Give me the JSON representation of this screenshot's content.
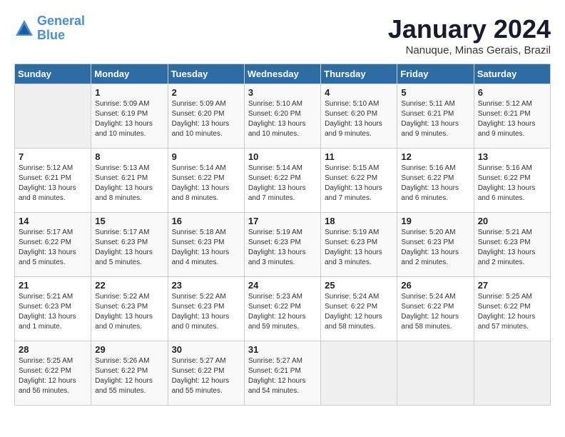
{
  "app": {
    "name": "GeneralBlue",
    "logo_line1": "General",
    "logo_line2": "Blue"
  },
  "calendar": {
    "month_year": "January 2024",
    "location": "Nanuque, Minas Gerais, Brazil",
    "days_of_week": [
      "Sunday",
      "Monday",
      "Tuesday",
      "Wednesday",
      "Thursday",
      "Friday",
      "Saturday"
    ],
    "weeks": [
      [
        {
          "day": "",
          "info": ""
        },
        {
          "day": "1",
          "info": "Sunrise: 5:09 AM\nSunset: 6:19 PM\nDaylight: 13 hours\nand 10 minutes."
        },
        {
          "day": "2",
          "info": "Sunrise: 5:09 AM\nSunset: 6:20 PM\nDaylight: 13 hours\nand 10 minutes."
        },
        {
          "day": "3",
          "info": "Sunrise: 5:10 AM\nSunset: 6:20 PM\nDaylight: 13 hours\nand 10 minutes."
        },
        {
          "day": "4",
          "info": "Sunrise: 5:10 AM\nSunset: 6:20 PM\nDaylight: 13 hours\nand 9 minutes."
        },
        {
          "day": "5",
          "info": "Sunrise: 5:11 AM\nSunset: 6:21 PM\nDaylight: 13 hours\nand 9 minutes."
        },
        {
          "day": "6",
          "info": "Sunrise: 5:12 AM\nSunset: 6:21 PM\nDaylight: 13 hours\nand 9 minutes."
        }
      ],
      [
        {
          "day": "7",
          "info": "Sunrise: 5:12 AM\nSunset: 6:21 PM\nDaylight: 13 hours\nand 8 minutes."
        },
        {
          "day": "8",
          "info": "Sunrise: 5:13 AM\nSunset: 6:21 PM\nDaylight: 13 hours\nand 8 minutes."
        },
        {
          "day": "9",
          "info": "Sunrise: 5:14 AM\nSunset: 6:22 PM\nDaylight: 13 hours\nand 8 minutes."
        },
        {
          "day": "10",
          "info": "Sunrise: 5:14 AM\nSunset: 6:22 PM\nDaylight: 13 hours\nand 7 minutes."
        },
        {
          "day": "11",
          "info": "Sunrise: 5:15 AM\nSunset: 6:22 PM\nDaylight: 13 hours\nand 7 minutes."
        },
        {
          "day": "12",
          "info": "Sunrise: 5:16 AM\nSunset: 6:22 PM\nDaylight: 13 hours\nand 6 minutes."
        },
        {
          "day": "13",
          "info": "Sunrise: 5:16 AM\nSunset: 6:22 PM\nDaylight: 13 hours\nand 6 minutes."
        }
      ],
      [
        {
          "day": "14",
          "info": "Sunrise: 5:17 AM\nSunset: 6:22 PM\nDaylight: 13 hours\nand 5 minutes."
        },
        {
          "day": "15",
          "info": "Sunrise: 5:17 AM\nSunset: 6:23 PM\nDaylight: 13 hours\nand 5 minutes."
        },
        {
          "day": "16",
          "info": "Sunrise: 5:18 AM\nSunset: 6:23 PM\nDaylight: 13 hours\nand 4 minutes."
        },
        {
          "day": "17",
          "info": "Sunrise: 5:19 AM\nSunset: 6:23 PM\nDaylight: 13 hours\nand 3 minutes."
        },
        {
          "day": "18",
          "info": "Sunrise: 5:19 AM\nSunset: 6:23 PM\nDaylight: 13 hours\nand 3 minutes."
        },
        {
          "day": "19",
          "info": "Sunrise: 5:20 AM\nSunset: 6:23 PM\nDaylight: 13 hours\nand 2 minutes."
        },
        {
          "day": "20",
          "info": "Sunrise: 5:21 AM\nSunset: 6:23 PM\nDaylight: 13 hours\nand 2 minutes."
        }
      ],
      [
        {
          "day": "21",
          "info": "Sunrise: 5:21 AM\nSunset: 6:23 PM\nDaylight: 13 hours\nand 1 minute."
        },
        {
          "day": "22",
          "info": "Sunrise: 5:22 AM\nSunset: 6:23 PM\nDaylight: 13 hours\nand 0 minutes."
        },
        {
          "day": "23",
          "info": "Sunrise: 5:22 AM\nSunset: 6:23 PM\nDaylight: 13 hours\nand 0 minutes."
        },
        {
          "day": "24",
          "info": "Sunrise: 5:23 AM\nSunset: 6:22 PM\nDaylight: 12 hours\nand 59 minutes."
        },
        {
          "day": "25",
          "info": "Sunrise: 5:24 AM\nSunset: 6:22 PM\nDaylight: 12 hours\nand 58 minutes."
        },
        {
          "day": "26",
          "info": "Sunrise: 5:24 AM\nSunset: 6:22 PM\nDaylight: 12 hours\nand 58 minutes."
        },
        {
          "day": "27",
          "info": "Sunrise: 5:25 AM\nSunset: 6:22 PM\nDaylight: 12 hours\nand 57 minutes."
        }
      ],
      [
        {
          "day": "28",
          "info": "Sunrise: 5:25 AM\nSunset: 6:22 PM\nDaylight: 12 hours\nand 56 minutes."
        },
        {
          "day": "29",
          "info": "Sunrise: 5:26 AM\nSunset: 6:22 PM\nDaylight: 12 hours\nand 55 minutes."
        },
        {
          "day": "30",
          "info": "Sunrise: 5:27 AM\nSunset: 6:22 PM\nDaylight: 12 hours\nand 55 minutes."
        },
        {
          "day": "31",
          "info": "Sunrise: 5:27 AM\nSunset: 6:21 PM\nDaylight: 12 hours\nand 54 minutes."
        },
        {
          "day": "",
          "info": ""
        },
        {
          "day": "",
          "info": ""
        },
        {
          "day": "",
          "info": ""
        }
      ]
    ]
  }
}
